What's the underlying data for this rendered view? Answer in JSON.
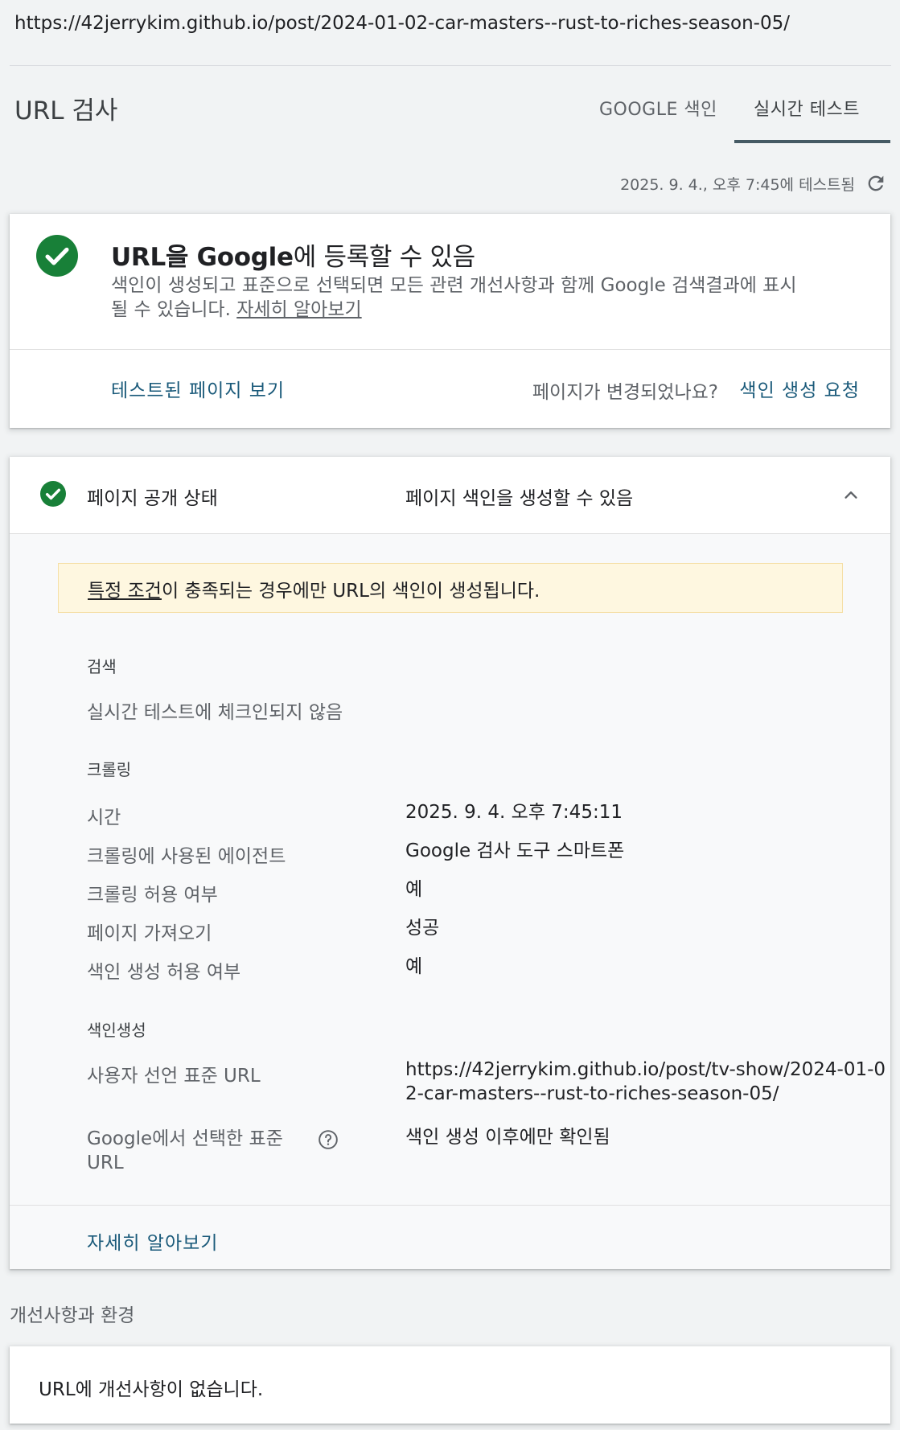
{
  "browser": {
    "url": "https://42jerrykim.github.io/post/2024-01-02-car-masters--rust-to-riches-season-05/"
  },
  "header": {
    "title": "URL 검사",
    "tabs": [
      {
        "label": "GOOGLE 색인",
        "active": false
      },
      {
        "label": "실시간 테스트",
        "active": true
      }
    ],
    "tested_at": "2025. 9. 4., 오후 7:45에 테스트됨"
  },
  "summary_card": {
    "title_bold": "URL을 Google",
    "title_rest": "에 등록할 수 있음",
    "description": "색인이 생성되고 표준으로 선택되면 모든 관련 개선사항과 함께 Google 검색결과에 표시될 수 있습니다. ",
    "learn_more": "자세히 알아보기",
    "view_tested_page": "테스트된 페이지 보기",
    "page_changed_question": "페이지가 변경되었나요?",
    "request_indexing": "색인 생성 요청"
  },
  "availability_card": {
    "title": "페이지 공개 상태",
    "status": "페이지 색인을 생성할 수 있음",
    "notice_link": "특정 조건",
    "notice_text": "이 충족되는 경우에만 URL의 색인이 생성됩니다.",
    "discovery": {
      "label": "검색",
      "value": "실시간 테스트에 체크인되지 않음"
    },
    "crawl": {
      "label": "크롤링",
      "rows": [
        {
          "label": "시간",
          "value": "2025. 9. 4. 오후 7:45:11"
        },
        {
          "label": "크롤링에 사용된 에이전트",
          "value": "Google 검사 도구 스마트폰"
        },
        {
          "label": "크롤링 허용 여부",
          "value": "예"
        },
        {
          "label": "페이지 가져오기",
          "value": "성공"
        },
        {
          "label": "색인 생성 허용 여부",
          "value": "예"
        }
      ]
    },
    "indexing": {
      "label": "색인생성",
      "user_canonical_label": "사용자 선언 표준 URL",
      "user_canonical_value_line1": "https://42jerrykim.github.io/post/tv-show/2024-01-0",
      "user_canonical_value_line2": "2-car-masters--rust-to-riches-season-05/",
      "google_canonical_label_line1": "Google에서 선택한 표준",
      "google_canonical_label_line2": "URL",
      "google_canonical_value": "색인 생성 이후에만 확인됨"
    },
    "learn_more": "자세히 알아보기"
  },
  "enhancements": {
    "title": "개선사항과 환경",
    "message": "URL에 개선사항이 없습니다."
  },
  "colors": {
    "success_green": "#188038",
    "link_teal": "#1a5a7a",
    "notice_bg": "#fef7e0"
  }
}
